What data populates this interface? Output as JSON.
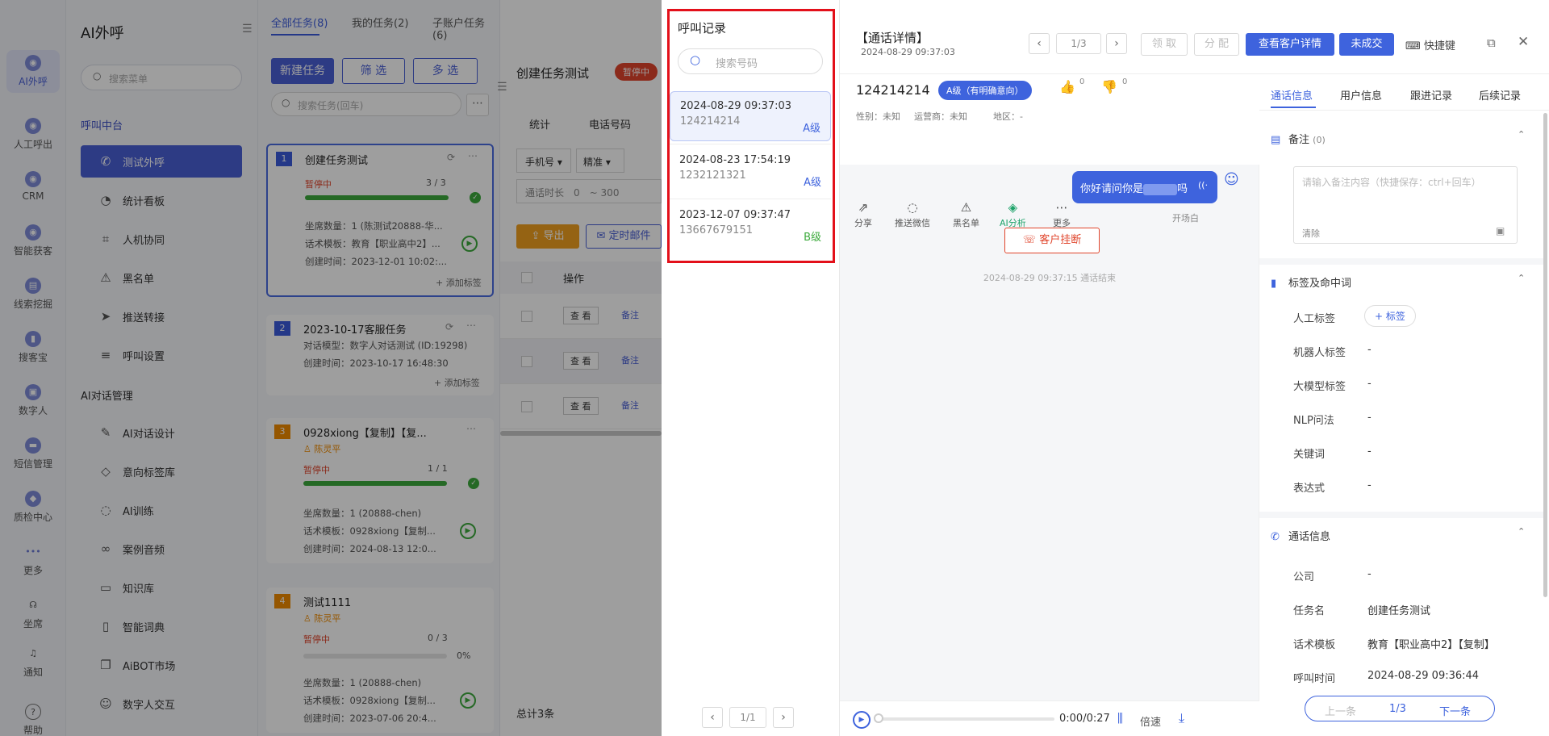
{
  "rail": {
    "items": [
      {
        "label": "AI外呼",
        "icon": "ai-call-icon",
        "active": true
      },
      {
        "label": "人工呼出",
        "icon": "manual-call-icon"
      },
      {
        "label": "CRM",
        "icon": "crm-icon"
      },
      {
        "label": "智能获客",
        "icon": "acquire-icon"
      },
      {
        "label": "线索挖掘",
        "icon": "lead-icon"
      },
      {
        "label": "搜客宝",
        "icon": "search-customer-icon"
      },
      {
        "label": "数字人",
        "icon": "digital-human-icon"
      },
      {
        "label": "短信管理",
        "icon": "sms-icon"
      },
      {
        "label": "质检中心",
        "icon": "qc-icon"
      },
      {
        "label": "更多",
        "icon": "more-icon"
      },
      {
        "label": "坐席",
        "icon": "headset-icon"
      },
      {
        "label": "通知",
        "icon": "bell-icon"
      },
      {
        "label": "帮助",
        "icon": "help-icon"
      }
    ]
  },
  "menu": {
    "title": "AI外呼",
    "search_placeholder": "搜索菜单",
    "group1": "呼叫中台",
    "items1": [
      "测试外呼",
      "统计看板",
      "人机协同",
      "黑名单",
      "推送转接",
      "呼叫设置"
    ],
    "group2": "AI对话管理",
    "items2": [
      "AI对话设计",
      "意向标签库",
      "AI训练",
      "案例音频",
      "知识库",
      "智能词典",
      "AiBOT市场",
      "数字人交互"
    ]
  },
  "tasks": {
    "tabs": [
      "全部任务(8)",
      "我的任务(2)",
      "子账户任务(6)"
    ],
    "new_task": "新建任务",
    "filter": "筛 选",
    "multi": "多 选",
    "search_placeholder": "搜索任务(回车)",
    "cards": [
      {
        "num": "1",
        "title": "创建任务测试",
        "status": "暂停中",
        "progress": "3 / 3",
        "fill": 1.0,
        "lines": [
          "坐席数量：1 (陈测试20888-华...",
          "话术模板：教育【职业高中2】...",
          "创建时间：2023-12-01 10:02:..."
        ],
        "add_tag": "+ 添加标签"
      },
      {
        "num": "2",
        "title": "2023-10-17客服任务",
        "lines": [
          "对话模型：数字人对话测试 (ID:19298)",
          "创建时间：2023-10-17 16:48:30"
        ],
        "add_tag": "+ 添加标签"
      },
      {
        "num": "3",
        "title": "0928xiong【复制】【复...",
        "owner": "陈灵平",
        "status": "暂停中",
        "progress": "1 / 1",
        "fill": 1.0,
        "lines": [
          "坐席数量：1 (20888-chen)",
          "话术模板：0928xiong【复制...",
          "创建时间：2024-08-13 12:0..."
        ]
      },
      {
        "num": "4",
        "title": "测试1111",
        "owner": "陈灵平",
        "status": "暂停中",
        "progress": "0 / 3",
        "pct": "0%",
        "fill": 0.0,
        "lines": [
          "坐席数量：1 (20888-chen)",
          "话术模板：0928xiong【复制...",
          "创建时间：2023-07-06 20:4..."
        ]
      }
    ]
  },
  "main": {
    "title": "创建任务测试",
    "status": "暂停中",
    "tabs": [
      "统计",
      "电话号码"
    ],
    "filters": [
      "手机号",
      "精准"
    ],
    "duration_label": "通话时长",
    "duration_from": "0",
    "duration_to": "300",
    "export": "导出",
    "schedule": "定时邮件",
    "col_op": "操作",
    "rows": [
      {
        "view": "查 看",
        "note": "备注"
      },
      {
        "view": "查 看",
        "note": "备注"
      },
      {
        "view": "查 看",
        "note": "备注"
      }
    ],
    "total": "总计3条"
  },
  "records": {
    "title": "呼叫记录",
    "search_placeholder": "搜索号码",
    "items": [
      {
        "time": "2024-08-29 09:37:03",
        "number": "124214214",
        "level": "A级",
        "level_color": "#3e63dd"
      },
      {
        "time": "2024-08-23 17:54:19",
        "number": "1232121321",
        "level": "A级",
        "level_color": "#3e63dd"
      },
      {
        "time": "2023-12-07 09:37:47",
        "number": "13667679151",
        "level": "B级",
        "level_color": "#3caa3c"
      }
    ],
    "pager": "1/1"
  },
  "detail": {
    "title": "【通话详情】",
    "time": "2024-08-29 09:37:03",
    "pager": "1/3",
    "btn_claim": "领 取",
    "btn_assign": "分 配",
    "btn_view_customer": "查看客户详情",
    "btn_not_deal": "未成交",
    "shortcut": "快捷键",
    "number": "124214214",
    "level_badge": "A级（有明确意向）",
    "likes": "0",
    "dislikes": "0",
    "gender": "性别：未知",
    "carrier": "运营商：未知",
    "region": "地区：-",
    "actions": [
      "分享",
      "推送微信",
      "黑名单",
      "AI分析",
      "更多"
    ],
    "chat_text": "你好请问你是",
    "chat_tail": "吗",
    "chat_caption": "开场白",
    "hangup": "客户挂断",
    "end_line": "2024-08-29 09:37:15 通话结束",
    "audio_time": "0:00/0:27",
    "speed": "倍速"
  },
  "side": {
    "tabs": [
      "通话信息",
      "用户信息",
      "跟进记录",
      "后续记录"
    ],
    "note_title": "备注",
    "note_count": "(0)",
    "note_placeholder": "请输入备注内容（快捷保存：ctrl+回车）",
    "note_clear": "清除",
    "tags_title": "标签及命中词",
    "tag_rows": [
      {
        "label": "人工标签",
        "value": "+ 标签"
      },
      {
        "label": "机器人标签",
        "value": "-"
      },
      {
        "label": "大模型标签",
        "value": "-"
      },
      {
        "label": "NLP问法",
        "value": "-"
      },
      {
        "label": "关键词",
        "value": "-"
      },
      {
        "label": "表达式",
        "value": "-"
      }
    ],
    "call_title": "通话信息",
    "call_rows": [
      {
        "label": "公司",
        "value": "-"
      },
      {
        "label": "任务名",
        "value": "创建任务测试"
      },
      {
        "label": "话术模板",
        "value": "教育【职业高中2】【复制】"
      },
      {
        "label": "呼叫时间",
        "value": "2024-08-29 09:36:44"
      }
    ],
    "prev": "上一条",
    "page": "1/3",
    "next": "下一条"
  },
  "colors": {
    "accent": "#4a5fd6",
    "highlight_border": "#e3101a",
    "green": "#3caa3c",
    "red": "#e0452c"
  }
}
